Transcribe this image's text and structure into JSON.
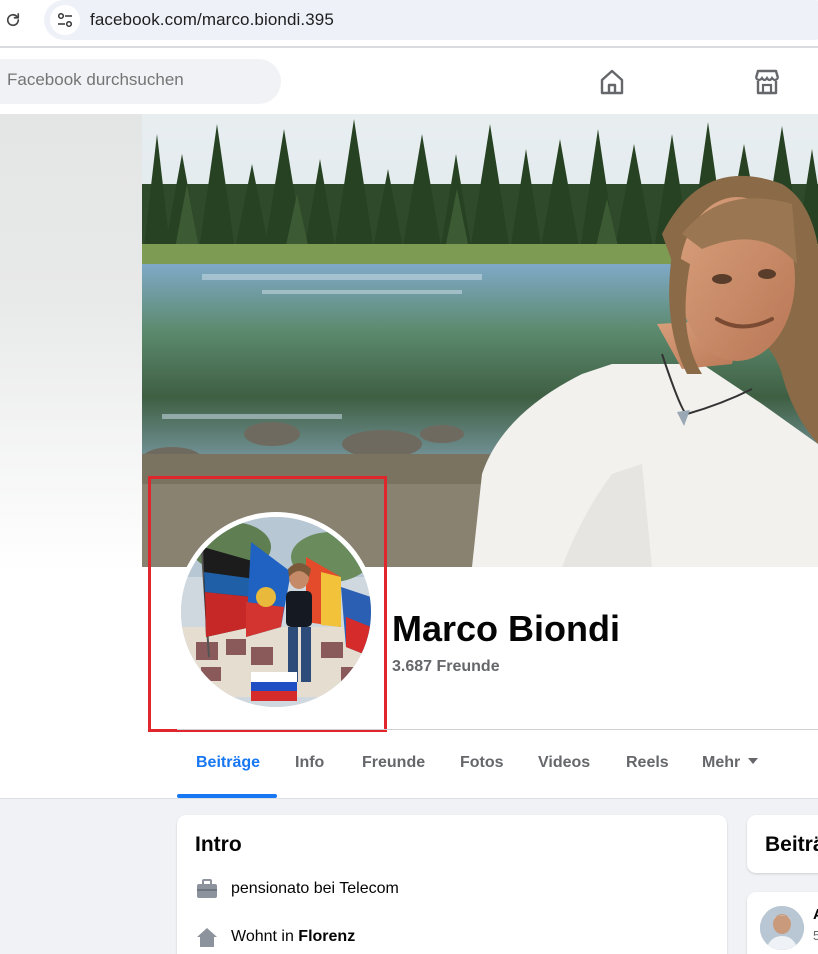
{
  "browser": {
    "url_domain": "facebook.com",
    "url_path": "/marco.biondi.395"
  },
  "header": {
    "search_placeholder": "Facebook durchsuchen",
    "icons": [
      "home-icon",
      "marketplace-icon"
    ]
  },
  "profile": {
    "name": "Marco Biondi",
    "friends": "3.687 Freunde"
  },
  "tabs": [
    {
      "label": "Beiträge",
      "active": true
    },
    {
      "label": "Info",
      "active": false
    },
    {
      "label": "Freunde",
      "active": false
    },
    {
      "label": "Fotos",
      "active": false
    },
    {
      "label": "Videos",
      "active": false
    },
    {
      "label": "Reels",
      "active": false
    },
    {
      "label": "Mehr",
      "active": false
    }
  ],
  "intro": {
    "title": "Intro",
    "work": "pensionato bei Telecom",
    "lives_prefix": "Wohnt in ",
    "lives_city": "Florenz"
  },
  "posts": {
    "title": "Beiträge",
    "first_post_initial": "A",
    "first_post_sub": "5"
  },
  "colors": {
    "accent": "#1877f2",
    "highlight": "#e0262c",
    "muted_text": "#65676b"
  }
}
